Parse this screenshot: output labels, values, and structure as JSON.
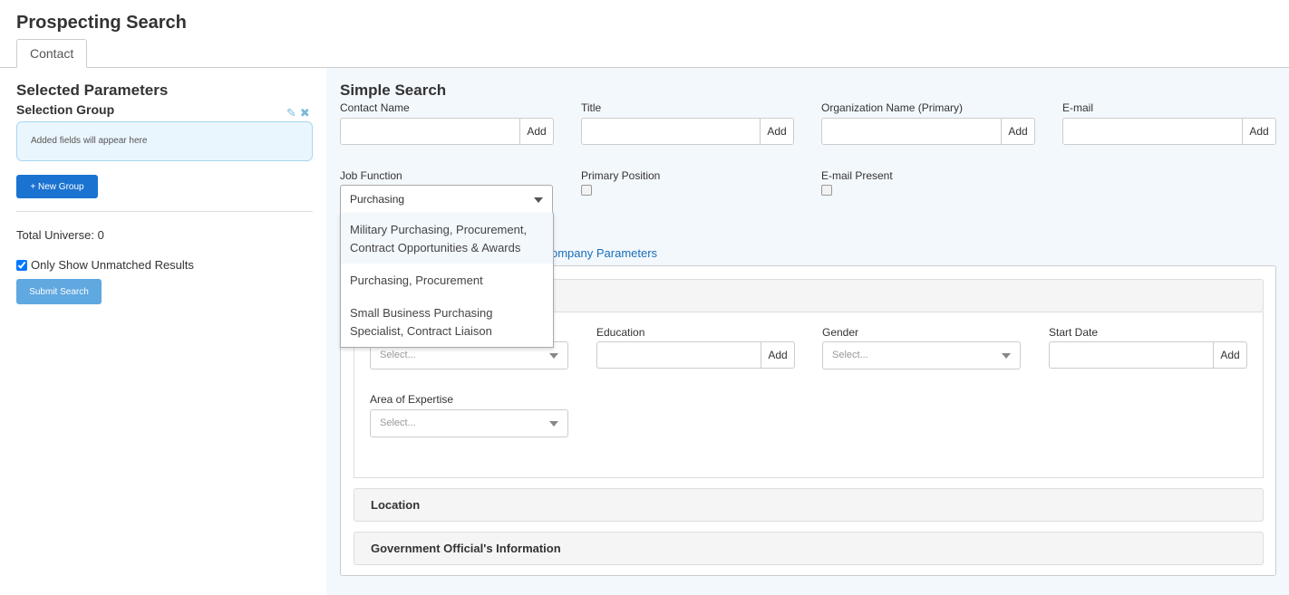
{
  "header": {
    "title": "Prospecting Search"
  },
  "tabs": [
    {
      "label": "Contact"
    }
  ],
  "left": {
    "heading": "Selected Parameters",
    "group_title": "Selection Group",
    "edit_icon": "edit-icon",
    "close_icon": "close-icon",
    "group_placeholder": "Added fields will appear here",
    "new_group_label": "+ New Group",
    "total_universe": "Total Universe: 0",
    "unmatched_label": "Only Show Unmatched Results",
    "unmatched_checked": true,
    "submit_label": "Submit Search"
  },
  "simple_search": {
    "heading": "Simple Search",
    "add_label": "Add",
    "fields": [
      {
        "label": "Contact Name",
        "value": ""
      },
      {
        "label": "Title",
        "value": ""
      },
      {
        "label": "Organization Name (Primary)",
        "value": ""
      },
      {
        "label": "E-mail",
        "value": ""
      }
    ],
    "job_function": {
      "label": "Job Function",
      "value": "Purchasing",
      "options": [
        "Military Purchasing, Procurement, Contract Opportunities & Awards",
        "Purchasing, Procurement",
        "Small Business Purchasing Specialist, Contract Liaison"
      ]
    },
    "primary_position": {
      "label": "Primary Position",
      "checked": false
    },
    "email_present": {
      "label": "E-mail Present",
      "checked": false
    }
  },
  "company_link": "ompany Parameters",
  "panel": {
    "fields": {
      "first_select_value": "Select...",
      "education_label": "Education",
      "gender_label": "Gender",
      "gender_value": "Select...",
      "start_date_label": "Start Date",
      "expertise_label": "Area of Expertise",
      "expertise_value": "Select..."
    },
    "sections": [
      {
        "label": "Location"
      },
      {
        "label": "Government Official's Information"
      }
    ]
  }
}
